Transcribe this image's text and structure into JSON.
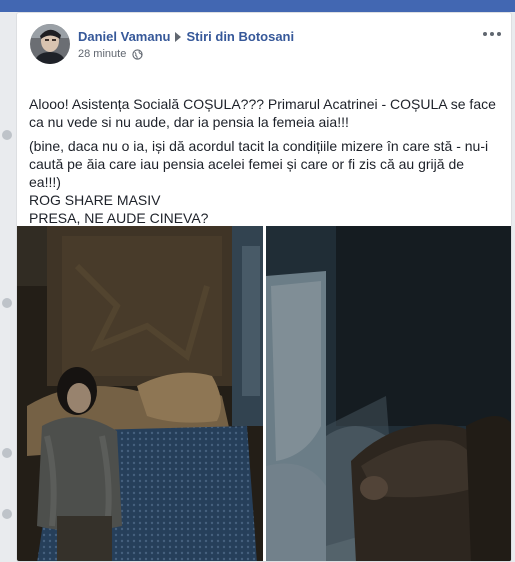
{
  "post": {
    "author": "Daniel Vamanu",
    "group": "Stiri din Botosani",
    "time": "28 minute",
    "paragraph1": "Alooo! Asistența Socială COȘULA??? Primarul Acatrinei - COȘULA se face ca nu vede si nu aude, dar ia pensia la femeia aia!!!",
    "paragraph2_lines": [
      "(bine, daca nu o ia, iși dă acordul tacit la condițiile mizere în care stă - nu-i caută pe ăia care iau pensia acelei femei și care or fi zis că au grijă de ea!!!)",
      "ROG SHARE MASIV",
      "PRESA, NE AUDE CINEVA?"
    ]
  },
  "icons": {
    "privacy": "globe-icon",
    "menu": "more-options-icon",
    "separator": "triangle-right-icon"
  },
  "colors": {
    "link": "#365899",
    "top_bar": "#4267b2",
    "background": "#e9ebee",
    "meta_text": "#616770"
  }
}
